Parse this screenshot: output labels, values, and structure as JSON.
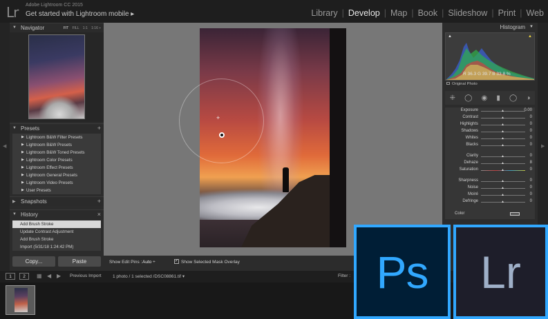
{
  "app": {
    "logo": "Lr",
    "version": "Adobe Lightroom CC 2015",
    "cta": "Get started with Lightroom mobile ▸"
  },
  "modules": [
    "Library",
    "Develop",
    "Map",
    "Book",
    "Slideshow",
    "Print",
    "Web"
  ],
  "active_module": "Develop",
  "navigator": {
    "title": "Navigator",
    "zoom_options": [
      "FIT",
      "FILL",
      "1:1",
      "1:16 ÷"
    ]
  },
  "presets": {
    "title": "Presets",
    "add": "+",
    "items": [
      "Lightroom B&W Filter Presets",
      "Lightroom B&W Presets",
      "Lightroom B&W Toned Presets",
      "Lightroom Color Presets",
      "Lightroom Effect Presets",
      "Lightroom General Presets",
      "Lightroom Video Presets",
      "User Presets"
    ]
  },
  "snapshots": {
    "title": "Snapshots",
    "add": "+"
  },
  "history": {
    "title": "History",
    "close": "×",
    "items": [
      "Add Brush Stroke",
      "Update Contrast Adjustment",
      "Add Brush Stroke",
      "Import (5/31/18 1:24:42 PM)"
    ]
  },
  "buttons": {
    "copy": "Copy...",
    "paste": "Paste"
  },
  "toolbar": {
    "pins_label": "Show Edit Pins :",
    "pins_value": "Auto ÷",
    "overlay_label": "Show Selected Mask Overlay",
    "overlay_checked": "✓"
  },
  "histogram": {
    "title": "Histogram",
    "readout": "R  36.3  G  39.7  B  33.8 %",
    "original_label": "Original Photo"
  },
  "adjustments": {
    "group1": [
      {
        "label": "Exposure",
        "value": "0.00"
      },
      {
        "label": "Contrast",
        "value": "0"
      },
      {
        "label": "Highlights",
        "value": "0"
      },
      {
        "label": "Shadows",
        "value": "0"
      },
      {
        "label": "Whites",
        "value": "0"
      },
      {
        "label": "Blacks",
        "value": "0"
      }
    ],
    "group2": [
      {
        "label": "Clarity",
        "value": "0"
      },
      {
        "label": "Dehaze",
        "value": "8"
      },
      {
        "label": "Saturation",
        "value": "0"
      }
    ],
    "group3": [
      {
        "label": "Sharpness",
        "value": "0"
      },
      {
        "label": "Noise",
        "value": "0"
      },
      {
        "label": "Moiré",
        "value": "0"
      },
      {
        "label": "Defringe",
        "value": "0"
      }
    ],
    "color_label": "Color"
  },
  "filmbar": {
    "view1": "1",
    "view2": "2",
    "source": "Previous Import",
    "selection": "1 photo / 1 selected /DSC08861.tif ▾",
    "filter": "Filter :"
  },
  "badges": {
    "ps": "Ps",
    "lr": "Lr"
  },
  "colors": {
    "accent": "#31a8ff",
    "badge_bg": "#001e36"
  }
}
